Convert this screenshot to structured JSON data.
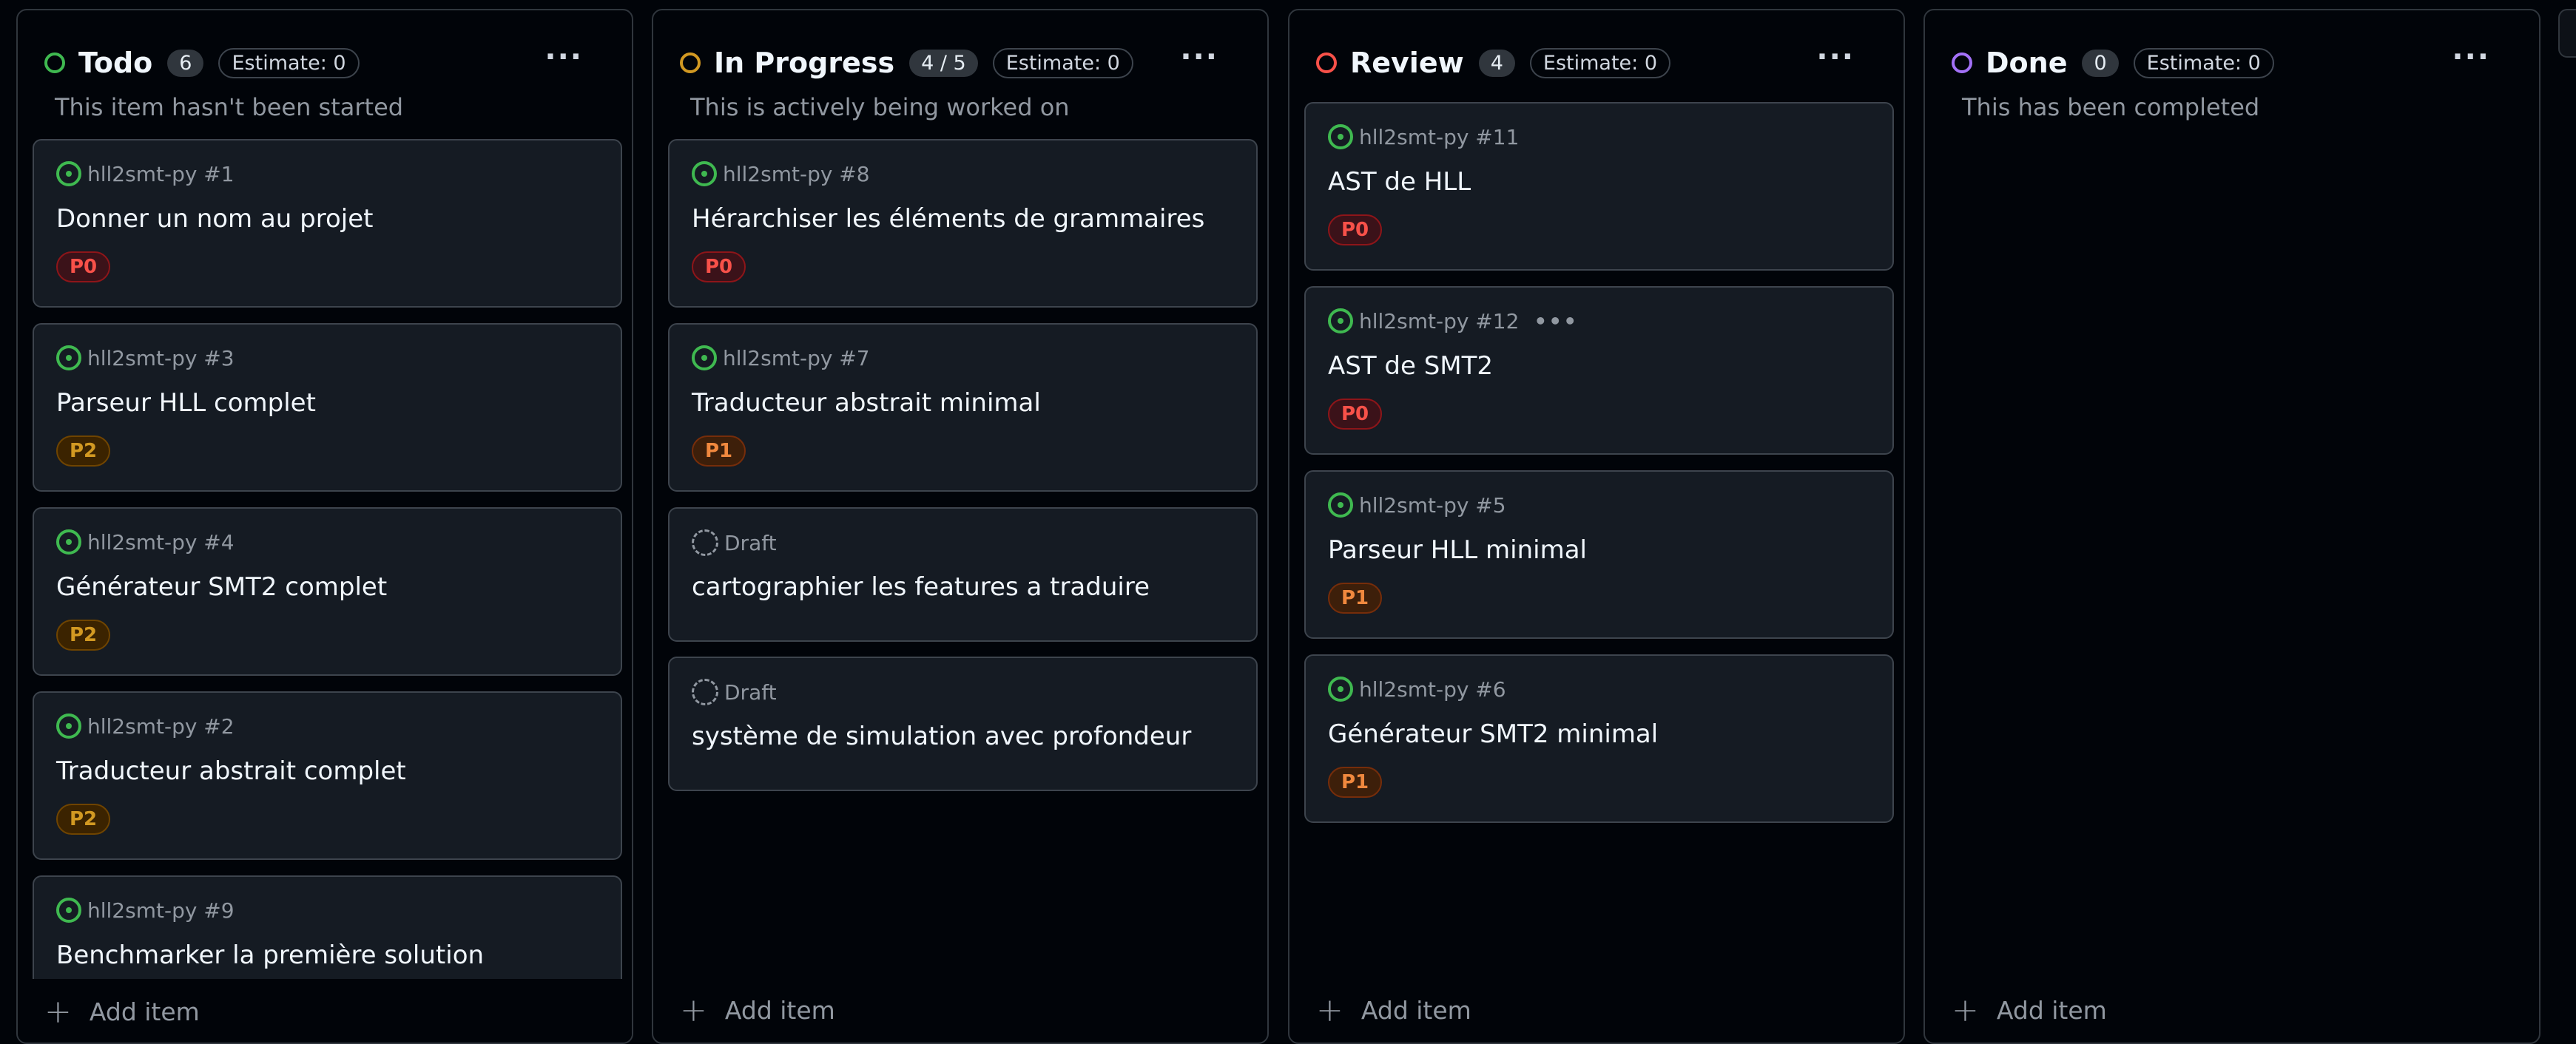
{
  "colors": {
    "todo_status": "#3fb950",
    "in_progress_status": "#d29922",
    "review_status": "#f85149",
    "done_status": "#a371f7",
    "p0": "#f85149",
    "p1": "#f0883e",
    "p2": "#d29922"
  },
  "columns": [
    {
      "title": "Todo",
      "count": "6",
      "estimate": "Estimate: 0",
      "menu": "···",
      "description": "This item hasn't been started",
      "add_item": "Add item",
      "cards": [
        {
          "repo": "hll2smt-py #1",
          "title": "Donner un nom au projet",
          "priority": "P0"
        },
        {
          "repo": "hll2smt-py #3",
          "title": "Parseur HLL complet",
          "priority": "P2"
        },
        {
          "repo": "hll2smt-py #4",
          "title": "Générateur SMT2 complet",
          "priority": "P2"
        },
        {
          "repo": "hll2smt-py #2",
          "title": "Traducteur abstrait complet",
          "priority": "P2"
        },
        {
          "repo": "hll2smt-py #9",
          "title": "Benchmarker la première solution"
        }
      ]
    },
    {
      "title": "In Progress",
      "count": "4 / 5",
      "estimate": "Estimate: 0",
      "menu": "···",
      "description": "This is actively being worked on",
      "add_item": "Add item",
      "cards": [
        {
          "repo": "hll2smt-py #8",
          "title": "Hérarchiser les éléments de grammaires",
          "priority": "P0"
        },
        {
          "repo": "hll2smt-py #7",
          "title": "Traducteur abstrait minimal",
          "priority": "P1"
        },
        {
          "repo": "Draft",
          "title": "cartographier les features a traduire"
        },
        {
          "repo": "Draft",
          "title": "système de simulation avec profondeur"
        }
      ]
    },
    {
      "title": "Review",
      "count": "4",
      "estimate": "Estimate: 0",
      "menu": "···",
      "description": "",
      "add_item": "Add item",
      "cards": [
        {
          "repo": "hll2smt-py #11",
          "title": "AST de HLL",
          "priority": "P0"
        },
        {
          "repo": "hll2smt-py #12",
          "more": "•••",
          "title": "AST de SMT2",
          "priority": "P0"
        },
        {
          "repo": "hll2smt-py #5",
          "title": "Parseur HLL minimal",
          "priority": "P1"
        },
        {
          "repo": "hll2smt-py #6",
          "title": "Générateur SMT2 minimal",
          "priority": "P1"
        }
      ]
    },
    {
      "title": "Done",
      "count": "0",
      "estimate": "Estimate: 0",
      "menu": "···",
      "description": "This has been completed",
      "add_item": "Add item",
      "cards": []
    }
  ]
}
